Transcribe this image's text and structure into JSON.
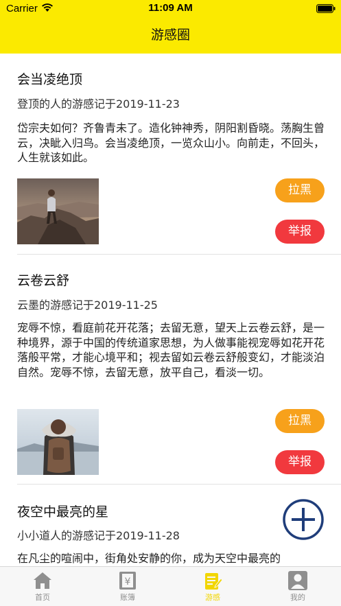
{
  "status_bar": {
    "carrier": "Carrier",
    "time": "11:09 AM"
  },
  "nav": {
    "title": "游感圈"
  },
  "posts": [
    {
      "title": "会当凌绝顶",
      "meta": "登顶的人的游感记于2019-11-23",
      "body": "岱宗夫如何？齐鲁青未了。造化钟神秀，阴阳割昏晓。荡胸生曾云，决眦入归鸟。会当凌绝顶，一览众山小。向前走，不回头，人生就该如此。",
      "block_label": "拉黑",
      "report_label": "举报"
    },
    {
      "title": "云卷云舒",
      "meta": "云墨的游感记于2019-11-25",
      "body": "宠辱不惊，看庭前花开花落；去留无意，望天上云卷云舒，是一种境界，源于中国的传统道家思想，为人做事能视宠辱如花开花落般平常，才能心境平和；视去留如云卷云舒般变幻，才能淡泊自然。宠辱不惊，去留无意，放平自己，看淡一切。",
      "block_label": "拉黑",
      "report_label": "举报"
    },
    {
      "title": "夜空中最亮的星",
      "meta": "小小道人的游感记于2019-11-28",
      "body": "在凡尘的喧闹中，街角处安静的你，成为天空中最亮的"
    }
  ],
  "tabs": [
    {
      "label": "首页",
      "icon": "home-icon"
    },
    {
      "label": "账簿",
      "icon": "ledger-icon"
    },
    {
      "label": "游感",
      "icon": "notes-icon"
    },
    {
      "label": "我的",
      "icon": "profile-icon"
    }
  ],
  "colors": {
    "nav_bg": "#fbea00",
    "block_button": "#f7a11b",
    "report_button": "#f1393e",
    "fab": "#1f3d7a",
    "tab_active": "#f2d600",
    "tab_inactive": "#8f8f8f"
  }
}
